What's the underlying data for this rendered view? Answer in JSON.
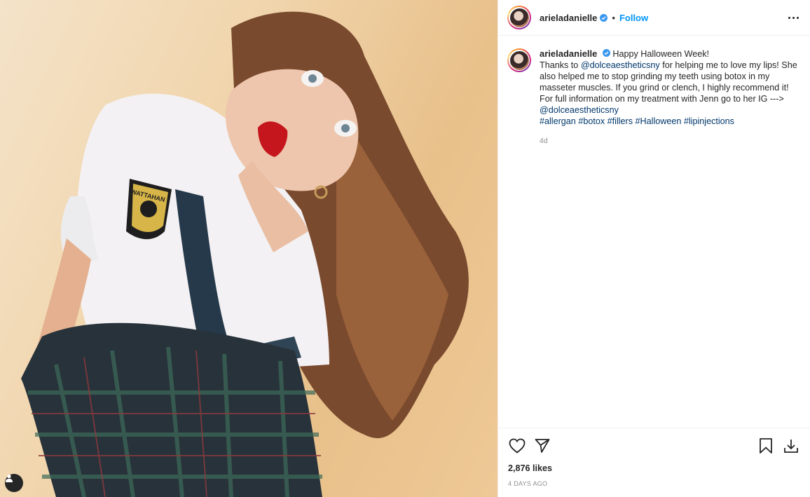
{
  "post": {
    "username": "arieladanielle",
    "follow_label": "Follow",
    "separator": "•",
    "caption": {
      "line1": "Happy Halloween Week!",
      "text_a": "Thanks to ",
      "mention1": "@dolceaestheticsny",
      "text_b": " for helping me to love my lips! She also helped me to stop grinding my teeth using botox in my masseter muscles. If you grind or clench, I highly recommend it! For full information on my treatment with Jenn go to her IG --->",
      "mention2": "@dolceaestheticsny",
      "hashtags": [
        "#allergan",
        "#botox",
        "#fillers",
        "#Halloween",
        "#lipinjections"
      ],
      "time": "4d"
    },
    "likes": "2,876 likes",
    "posted_ago": "4 DAYS AGO"
  },
  "photo": {
    "patch_text": "WATTAHAN"
  },
  "icons": {
    "header_more": "more-options-icon",
    "like": "heart-icon",
    "share": "paper-plane-icon",
    "save": "bookmark-icon",
    "download": "download-icon",
    "tag": "user-tag-icon",
    "verified": "verified-badge-icon"
  },
  "colors": {
    "link": "#00376b",
    "follow": "#0095f6",
    "verified": "#3897f0",
    "muted": "#8e8e8e"
  }
}
